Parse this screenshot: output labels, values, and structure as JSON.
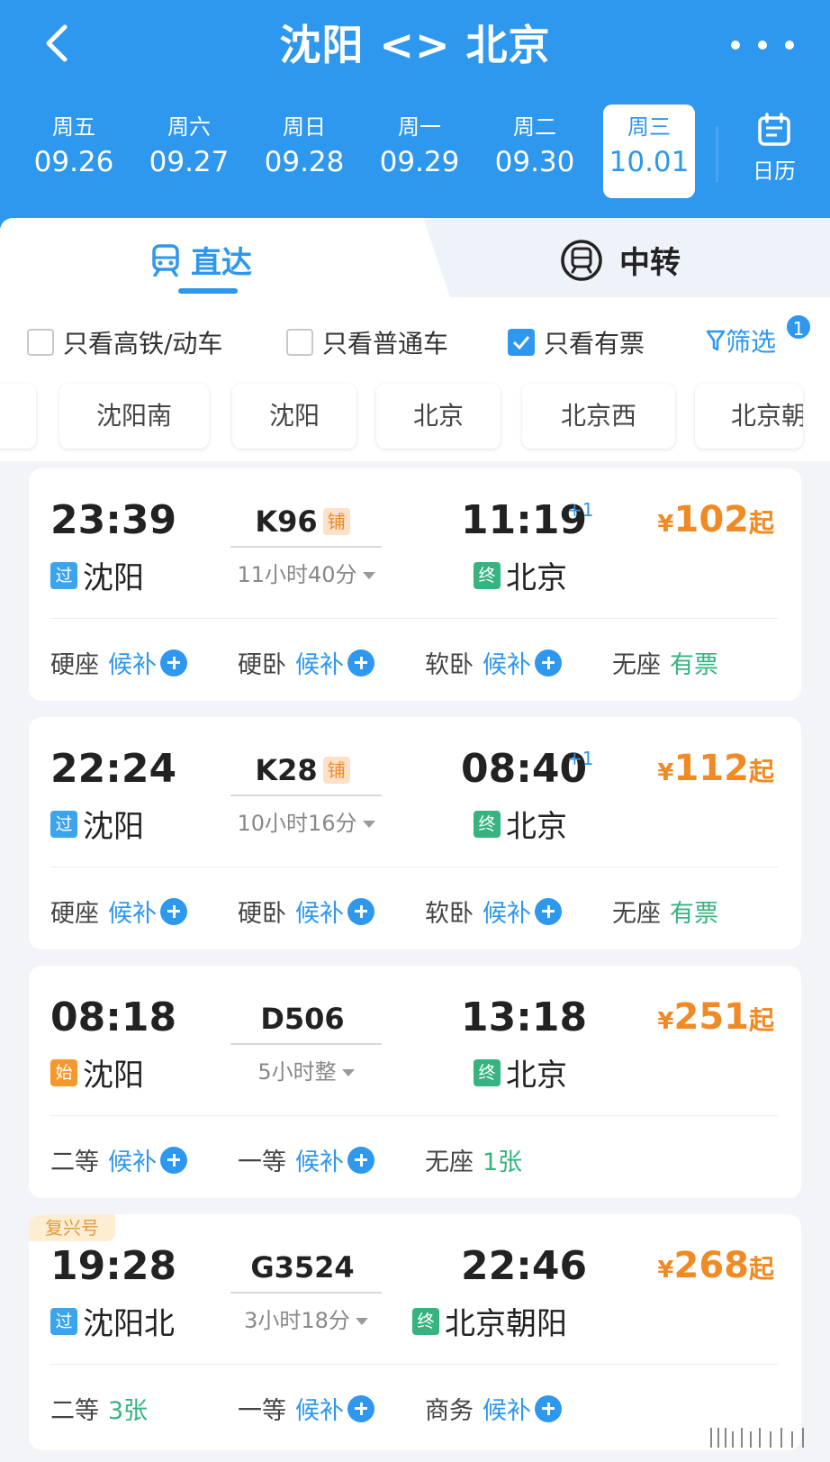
{
  "header": {
    "title": "沈阳 <> 北京",
    "dates": [
      {
        "weekday": "周五",
        "date": "09.26"
      },
      {
        "weekday": "周六",
        "date": "09.27"
      },
      {
        "weekday": "周日",
        "date": "09.28"
      },
      {
        "weekday": "周一",
        "date": "09.29"
      },
      {
        "weekday": "周二",
        "date": "09.30"
      },
      {
        "weekday": "周三",
        "date": "10.01"
      }
    ],
    "calendar_label": "日历",
    "accent": "#2e97ee"
  },
  "mode_tabs": {
    "direct": "直达",
    "transfer": "中转"
  },
  "filters": {
    "high_speed": "只看高铁/动车",
    "regular": "只看普通车",
    "available": "只看有票",
    "filter_label": "筛选",
    "filter_badge": "1"
  },
  "stations": [
    "沈阳南",
    "沈阳",
    "北京",
    "北京西",
    "北京朝"
  ],
  "trains": [
    {
      "dep_time": "23:39",
      "dep_tag": "过",
      "dep_station": "沈阳",
      "train_no": "K96",
      "sleeper_tag": "铺",
      "duration": "11小时40分",
      "arr_time": "11:19",
      "arr_plus": "+1",
      "arr_tag": "终",
      "arr_station": "北京",
      "price_symbol": "¥",
      "price": "102",
      "price_suffix": "起",
      "seats": [
        {
          "name": "硬座",
          "status": "候补"
        },
        {
          "name": "硬卧",
          "status": "候补"
        },
        {
          "name": "软卧",
          "status": "候补"
        },
        {
          "name": "无座",
          "status": "有票"
        }
      ]
    },
    {
      "dep_time": "22:24",
      "dep_tag": "过",
      "dep_station": "沈阳",
      "train_no": "K28",
      "sleeper_tag": "铺",
      "duration": "10小时16分",
      "arr_time": "08:40",
      "arr_plus": "+1",
      "arr_tag": "终",
      "arr_station": "北京",
      "price_symbol": "¥",
      "price": "112",
      "price_suffix": "起",
      "seats": [
        {
          "name": "硬座",
          "status": "候补"
        },
        {
          "name": "硬卧",
          "status": "候补"
        },
        {
          "name": "软卧",
          "status": "候补"
        },
        {
          "name": "无座",
          "status": "有票"
        }
      ]
    },
    {
      "dep_time": "08:18",
      "dep_tag": "始",
      "dep_station": "沈阳",
      "train_no": "D506",
      "duration": "5小时整",
      "arr_time": "13:18",
      "arr_tag": "终",
      "arr_station": "北京",
      "price_symbol": "¥",
      "price": "251",
      "price_suffix": "起",
      "seats": [
        {
          "name": "二等",
          "status": "候补"
        },
        {
          "name": "一等",
          "status": "候补"
        },
        {
          "name": "无座",
          "status": "1张"
        }
      ]
    },
    {
      "badge": "复兴号",
      "dep_time": "19:28",
      "dep_tag": "过",
      "dep_station": "沈阳北",
      "train_no": "G3524",
      "duration": "3小时18分",
      "arr_time": "22:46",
      "arr_tag": "终",
      "arr_station": "北京朝阳",
      "price_symbol": "¥",
      "price": "268",
      "price_suffix": "起",
      "seats": [
        {
          "name": "二等",
          "status": "3张"
        },
        {
          "name": "一等",
          "status": "候补"
        },
        {
          "name": "商务",
          "status": "候补"
        }
      ]
    }
  ]
}
